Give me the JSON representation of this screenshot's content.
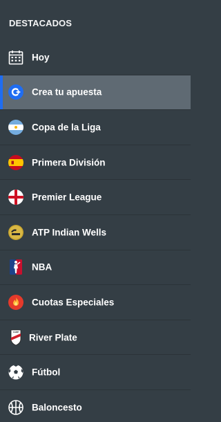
{
  "section_title": "DESTACADOS",
  "colors": {
    "background": "#343e45",
    "active_background": "#5f6a73",
    "active_indicator": "#1f6df2",
    "text": "#ffffff"
  },
  "items": [
    {
      "label": "Hoy",
      "icon": "calendar-icon"
    },
    {
      "label": "Crea tu apuesta",
      "icon": "create-bet-icon",
      "active": true
    },
    {
      "label": "Copa de la Liga",
      "icon": "argentina-flag-icon"
    },
    {
      "label": "Primera División",
      "icon": "spain-flag-icon"
    },
    {
      "label": "Premier League",
      "icon": "england-flag-icon"
    },
    {
      "label": "ATP Indian Wells",
      "icon": "atp-logo-icon"
    },
    {
      "label": "NBA",
      "icon": "nba-logo-icon"
    },
    {
      "label": "Cuotas Especiales",
      "icon": "fire-icon"
    },
    {
      "label": "River Plate",
      "icon": "river-plate-crest-icon"
    },
    {
      "label": "Fútbol",
      "icon": "soccer-ball-icon"
    },
    {
      "label": "Baloncesto",
      "icon": "basketball-icon"
    }
  ]
}
